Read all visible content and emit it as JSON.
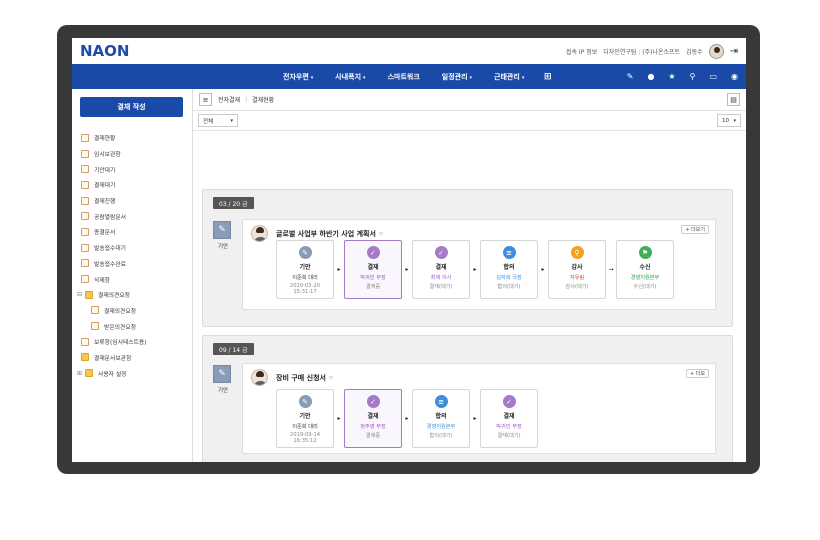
{
  "header": {
    "logo": "NAON",
    "ip_info": "접속 IP 정보",
    "org_label": "디자인연구팀 : (주)나온소프트",
    "user_name": "김동수"
  },
  "nav": {
    "items": [
      "전자우편",
      "사내폭지",
      "스마트워크",
      "일정관리",
      "근태관리"
    ],
    "has_caret": [
      true,
      true,
      false,
      true,
      true
    ]
  },
  "sidebar": {
    "write_button": "결재 작성",
    "items": [
      {
        "label": "결재현황",
        "type": "doc"
      },
      {
        "label": "임시보관함",
        "type": "doc"
      },
      {
        "label": "기안대기",
        "type": "doc"
      },
      {
        "label": "결재대기",
        "type": "doc"
      },
      {
        "label": "결재진행",
        "type": "doc"
      },
      {
        "label": "공람열람문서",
        "type": "doc"
      },
      {
        "label": "종결문서",
        "type": "doc"
      },
      {
        "label": "발송접수대기",
        "type": "doc"
      },
      {
        "label": "발송접수완료",
        "type": "doc"
      },
      {
        "label": "삭제함",
        "type": "doc"
      },
      {
        "label": "결재의견요청",
        "type": "folder",
        "toggle": "⊟"
      },
      {
        "label": "결재의견요청",
        "type": "doc",
        "sub": true
      },
      {
        "label": "받은의견요청",
        "type": "doc",
        "sub": true
      },
      {
        "label": "보류함(임시테스트용)",
        "type": "doc"
      },
      {
        "label": "결재문서보관함",
        "type": "folder"
      },
      {
        "label": "사용자 설정",
        "type": "folder",
        "toggle": "⊞"
      }
    ]
  },
  "breadcrumb": {
    "section": "전자결재",
    "page": "결재현황"
  },
  "filter": {
    "scope": "전체",
    "page_size": "10"
  },
  "groups": [
    {
      "date": "03 / 20 금",
      "kind": "기안",
      "title": "글로벌 사업부 하반기 사업 계획서",
      "more": "+ 더보기",
      "steps": [
        {
          "label": "기안",
          "name": "이준희 대리",
          "status": "2020-03-20",
          "status2": "15:31:17",
          "color": "#8a9bb5",
          "icon": "✎",
          "name_color": "#333",
          "current": false
        },
        {
          "label": "결재",
          "name": "박귀민 부장",
          "status": "결재중",
          "status2": "",
          "color": "#a57bc8",
          "icon": "✓",
          "name_color": "#a057c8",
          "current": true
        },
        {
          "label": "결재",
          "name": "최재 이사",
          "status": "결재(대기)",
          "status2": "",
          "color": "#a57bc8",
          "icon": "✓",
          "name_color": "#a057c8",
          "current": false
        },
        {
          "label": "합의",
          "name": "김하희 국장",
          "status": "합의(대기)",
          "status2": "",
          "color": "#3d8fd9",
          "icon": "≡",
          "name_color": "#3d8fd9",
          "current": false
        },
        {
          "label": "감사",
          "name": "자유림",
          "status": "감사(대기)",
          "status2": "",
          "color": "#f2a21b",
          "icon": "⚲",
          "name_color": "#e0462a",
          "current": false
        },
        {
          "label": "수신",
          "name": "경영지원본부",
          "status": "수신(대기)",
          "status2": "",
          "color": "#3db05a",
          "icon": "⚑",
          "name_color": "#2e9d4b",
          "current": false
        }
      ],
      "arrows": [
        "▸",
        "▸",
        "▸",
        "▸",
        "→"
      ]
    },
    {
      "date": "09 / 14 금",
      "kind": "기안",
      "title": "장비 구매 신청서",
      "more": "+ 더보",
      "steps": [
        {
          "label": "기안",
          "name": "이준희 대리",
          "status": "2019-09-14",
          "status2": "16:35:12",
          "color": "#8a9bb5",
          "icon": "✎",
          "name_color": "#333",
          "current": false
        },
        {
          "label": "결재",
          "name": "정주영 부장",
          "status": "결재중",
          "status2": "",
          "color": "#a57bc8",
          "icon": "✓",
          "name_color": "#a057c8",
          "current": true
        },
        {
          "label": "합의",
          "name": "경영지원본부",
          "status": "합의(대기)",
          "status2": "",
          "color": "#3d8fd9",
          "icon": "≡",
          "name_color": "#3d8fd9",
          "current": false
        },
        {
          "label": "결재",
          "name": "박귀민 부장",
          "status": "결재(대기)",
          "status2": "",
          "color": "#a57bc8",
          "icon": "✓",
          "name_color": "#a057c8",
          "current": false
        }
      ],
      "arrows": [
        "▸",
        "▸",
        "▸"
      ]
    }
  ]
}
